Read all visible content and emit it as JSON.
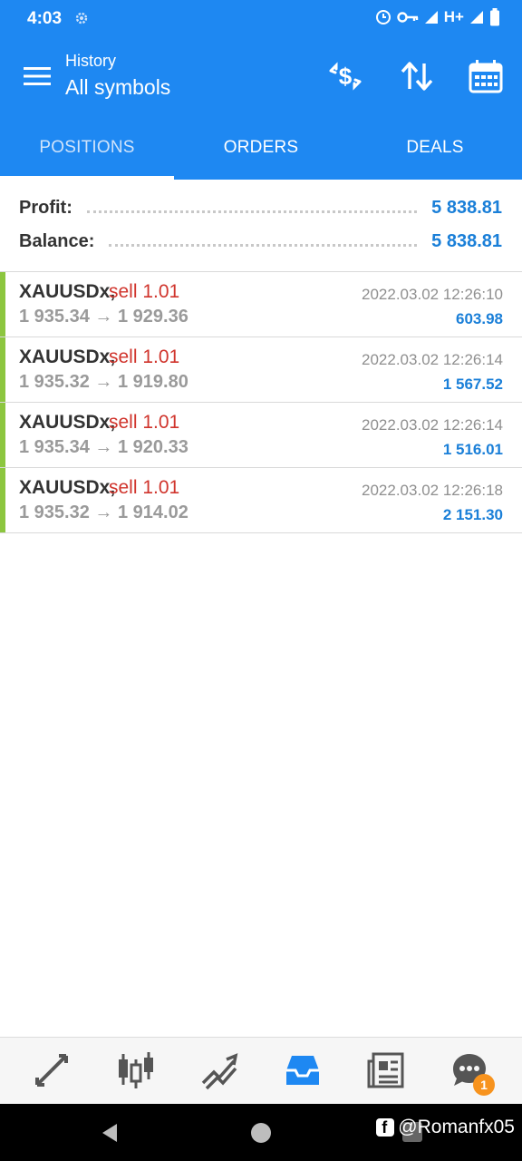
{
  "status_bar": {
    "time": "4:03",
    "network": "H+"
  },
  "header": {
    "subtitle": "History",
    "title": "All symbols"
  },
  "tabs": [
    {
      "label": "POSITIONS",
      "active": true
    },
    {
      "label": "ORDERS",
      "active": false
    },
    {
      "label": "DEALS",
      "active": false
    }
  ],
  "summary": {
    "profit_label": "Profit:",
    "profit_value": "5 838.81",
    "balance_label": "Balance:",
    "balance_value": "5 838.81"
  },
  "positions": [
    {
      "symbol": "XAUUSDx,",
      "side": "sell 1.01",
      "prices": "1 935.34 → 1 929.36",
      "datetime": "2022.03.02 12:26:10",
      "profit": "603.98"
    },
    {
      "symbol": "XAUUSDx,",
      "side": "sell 1.01",
      "prices": "1 935.32 → 1 919.80",
      "datetime": "2022.03.02 12:26:14",
      "profit": "1 567.52"
    },
    {
      "symbol": "XAUUSDx,",
      "side": "sell 1.01",
      "prices": "1 935.34 → 1 920.33",
      "datetime": "2022.03.02 12:26:14",
      "profit": "1 516.01"
    },
    {
      "symbol": "XAUUSDx,",
      "side": "sell 1.01",
      "prices": "1 935.32 → 1 914.02",
      "datetime": "2022.03.02 12:26:18",
      "profit": "2 151.30"
    }
  ],
  "bottom_nav": {
    "items": [
      "quotes-icon",
      "chart-icon",
      "trade-icon",
      "history-icon",
      "news-icon",
      "chat-icon"
    ],
    "active": "history-icon",
    "chat_badge": "1"
  },
  "watermark": "@Romanfx05",
  "colors": {
    "primary": "#1e88f2",
    "profit_blue": "#1a7fd8",
    "sell_red": "#d0342c",
    "position_bar": "#8cc63f",
    "badge": "#f7931e"
  }
}
